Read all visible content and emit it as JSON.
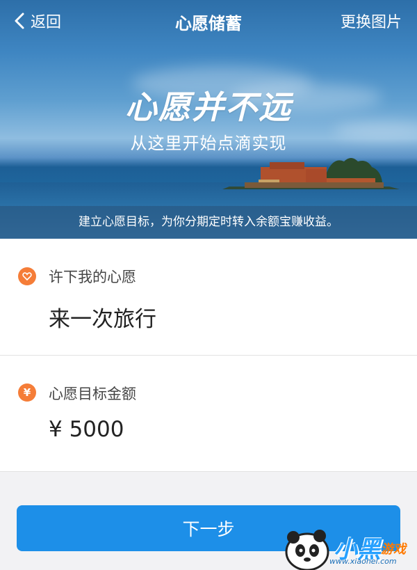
{
  "header": {
    "back_label": "返回",
    "title": "心愿储蓄",
    "change_image_label": "更换图片"
  },
  "hero": {
    "slogan": "心愿并不远",
    "subslogan": "从这里开始点滴实现",
    "info": "建立心愿目标，为你分期定时转入余额宝赚收益。"
  },
  "wish": {
    "icon": "heart-icon",
    "label": "许下我的心愿",
    "value": "来一次旅行"
  },
  "amount": {
    "icon": "yen-icon",
    "label": "心愿目标金额",
    "value": "¥ 5000"
  },
  "actions": {
    "next_label": "下一步"
  },
  "watermark": {
    "text_main": "小黑",
    "text_sub": "游戏",
    "url": "www.xiaohei.com"
  },
  "colors": {
    "accent_blue": "#1d8fe8",
    "badge_orange": "#f57d38"
  }
}
